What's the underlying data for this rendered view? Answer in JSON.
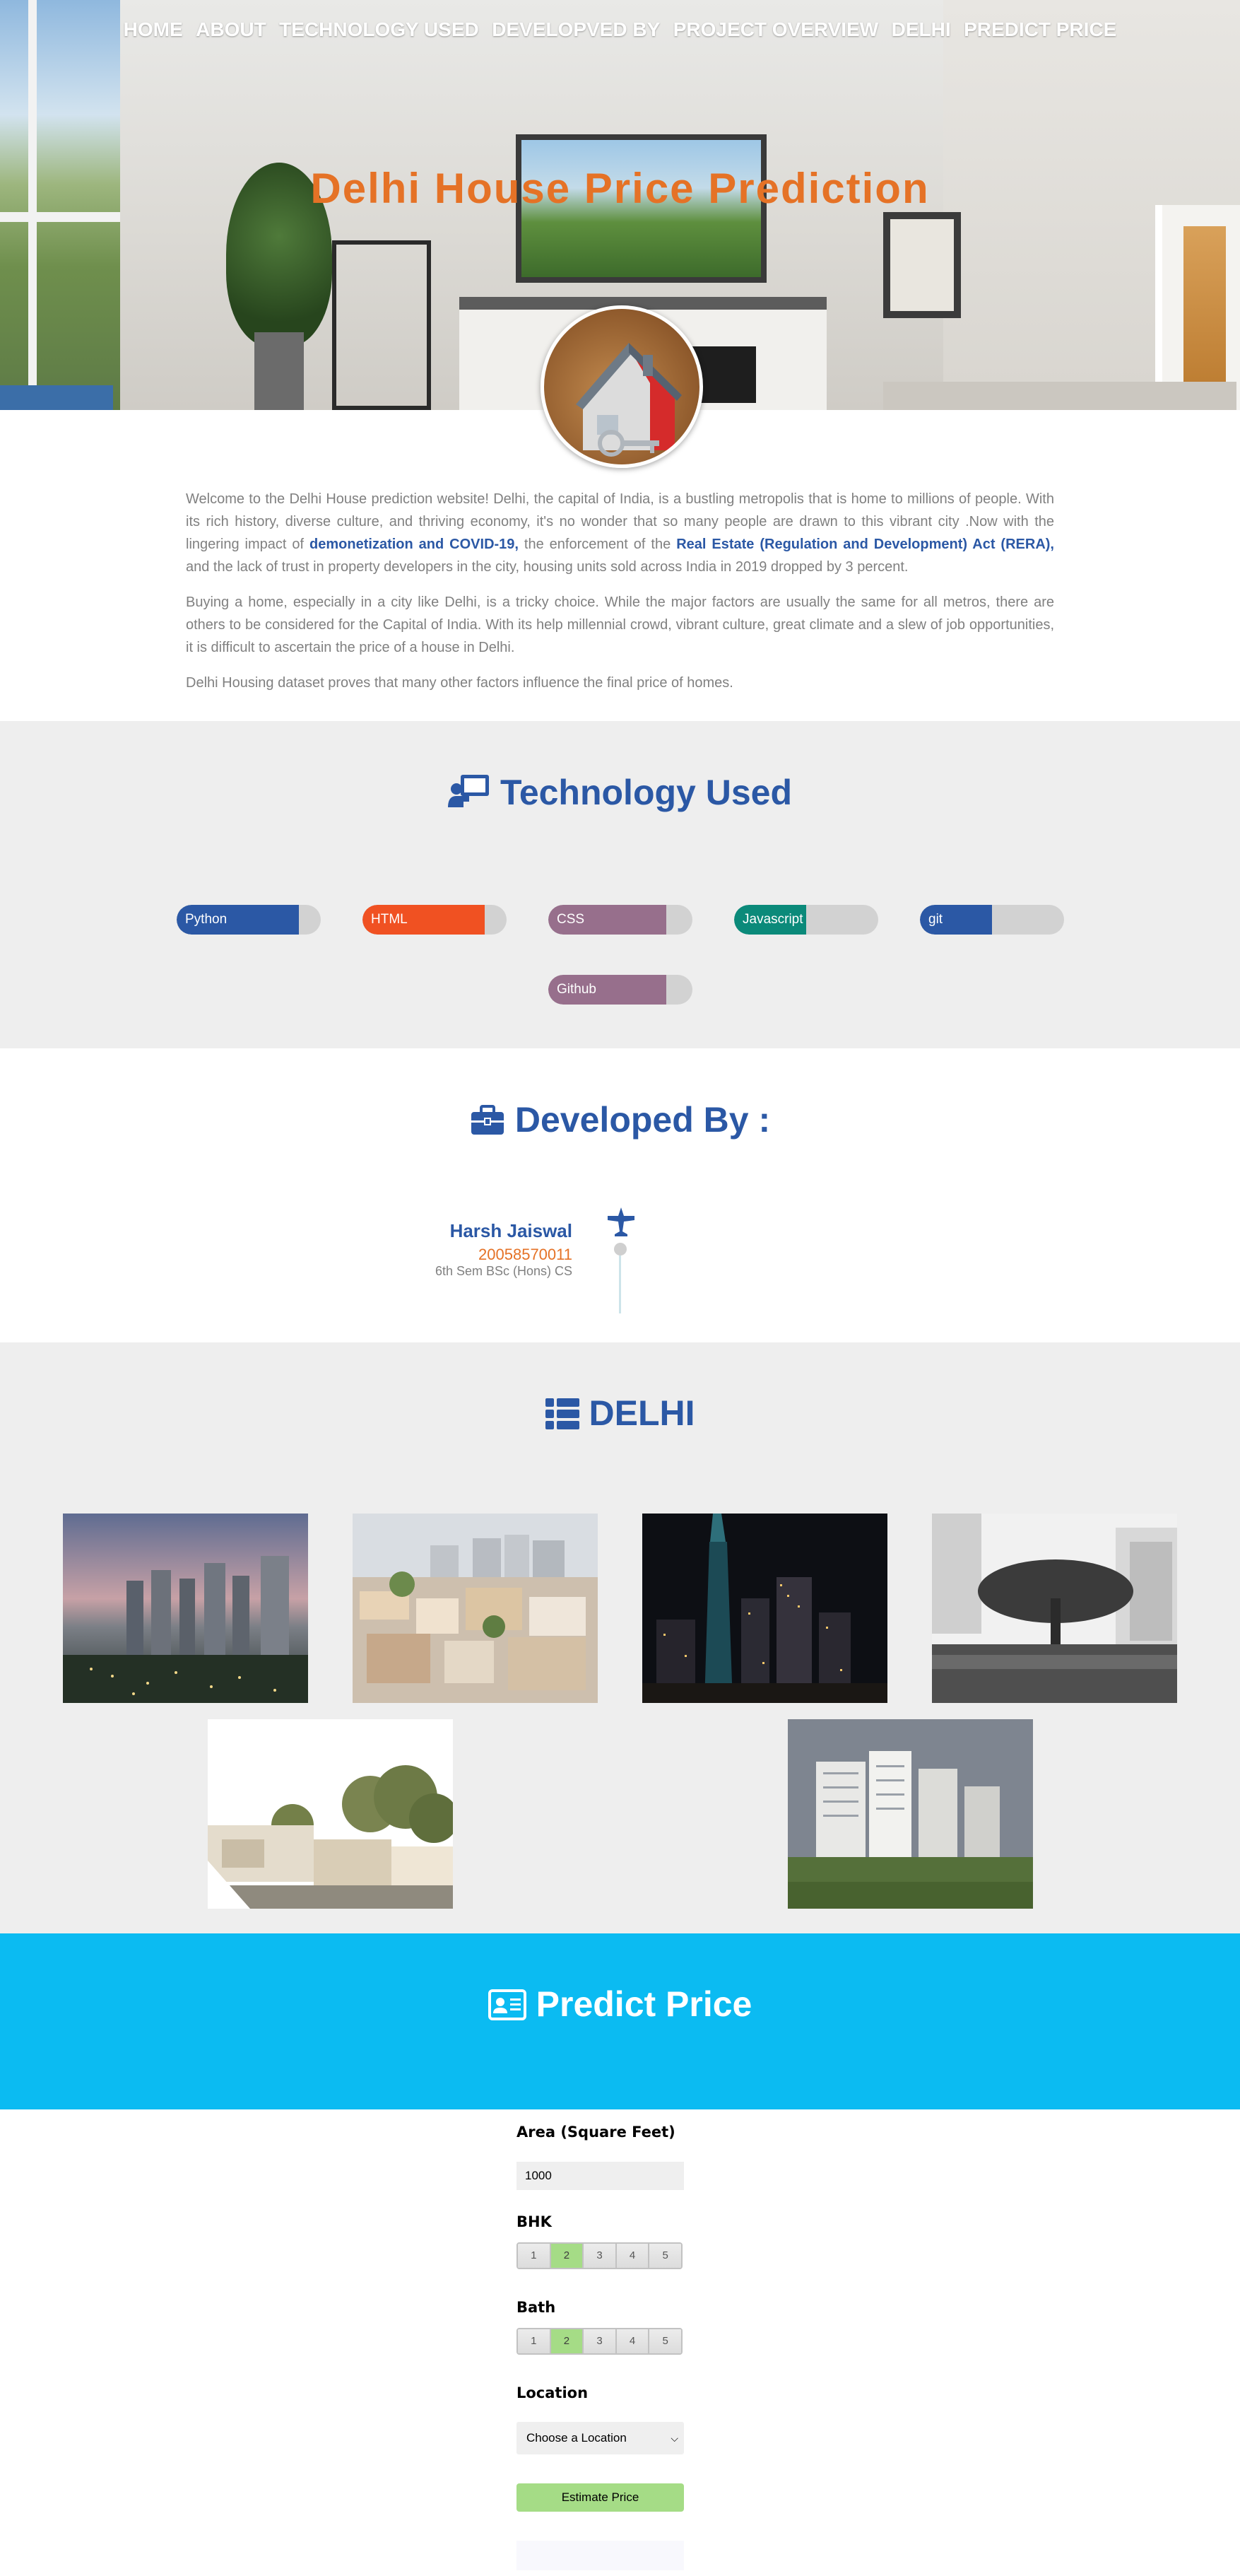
{
  "nav": {
    "items": [
      "HOME",
      "ABOUT",
      "TECHNOLOGY USED",
      "DEVELOPVED BY",
      "PROJECT OVERVIEW",
      "DELHI",
      "PREDICT PRICE"
    ]
  },
  "hero": {
    "title": "Delhi House Price Prediction"
  },
  "about": {
    "p1_a": "Welcome to the Delhi House prediction website! Delhi, the capital of India, is a bustling metropolis that is home to millions of people. With its rich history, diverse culture, and thriving economy, it's no wonder that so many people are drawn to this vibrant city .Now with the lingering impact of ",
    "p1_b1": "demonetization and COVID-19,",
    "p1_c": " the enforcement of the ",
    "p1_b2": "Real Estate (Regulation and Development) Act (RERA),",
    "p1_d": " and the lack of trust in property developers in the city, housing units sold across India in 2019 dropped by 3 percent.",
    "p2": "Buying a home, especially in a city like Delhi, is a tricky choice. While the major factors are usually the same for all metros, there are others to be considered for the Capital of India. With its help millennial crowd, vibrant culture, great climate and a slew of job opportunities, it is difficult to ascertain the price of a house in Delhi.",
    "p3": "Delhi Housing dataset proves that many other factors influence the final price of homes."
  },
  "technology": {
    "title": "Technology Used",
    "skills": [
      {
        "name": "Python",
        "level": 0.85,
        "color": "#2b58a5"
      },
      {
        "name": "HTML",
        "level": 0.85,
        "color": "#f05122"
      },
      {
        "name": "CSS",
        "level": 0.82,
        "color": "#976f8c"
      },
      {
        "name": "Javascript",
        "level": 0.5,
        "color": "#0b8a7a"
      },
      {
        "name": "git",
        "level": 0.5,
        "color": "#2b58a5"
      },
      {
        "name": "Github",
        "level": 0.82,
        "color": "#976f8c"
      }
    ]
  },
  "developer": {
    "title": "Developed By :",
    "name": "Harsh Jaiswal",
    "id": "20058570011",
    "course": "6th Sem BSc (Hons) CS"
  },
  "delhi": {
    "title": "DELHI",
    "photos": [
      "city-dusk-skyline-photo",
      "dense-town-rooftops-photo",
      "night-tower-lights-photo",
      "bw-tree-lake-photo",
      "trees-houses-photo",
      "apartment-blocks-photo"
    ]
  },
  "predict": {
    "title": "Predict Price",
    "area_label": "Area (Square Feet)",
    "area_value": "1000",
    "bhk_label": "BHK",
    "bhk_options": [
      "1",
      "2",
      "3",
      "4",
      "5"
    ],
    "bhk_selected": "2",
    "bath_label": "Bath",
    "bath_options": [
      "1",
      "2",
      "3",
      "4",
      "5"
    ],
    "bath_selected": "2",
    "location_label": "Location",
    "location_placeholder": "Choose a Location",
    "estimate_button": "Estimate Price"
  },
  "colors": {
    "brand_blue": "#2b58a5",
    "accent_orange": "#e57226",
    "predict_band": "#0bbbf2",
    "toggle_green": "#a5dc86"
  }
}
